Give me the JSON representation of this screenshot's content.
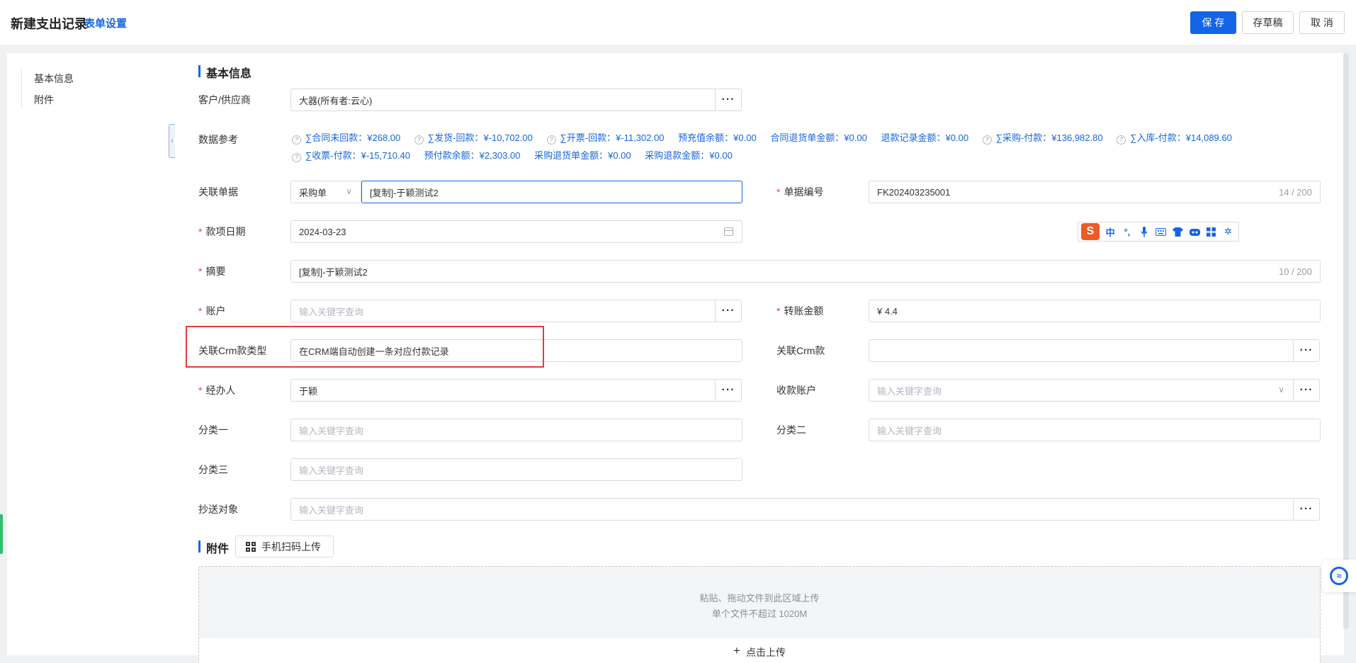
{
  "header": {
    "title": "新建支出记录",
    "form_settings": "表单设置",
    "save": "保 存",
    "save_draft": "存草稿",
    "cancel": "取 消"
  },
  "sidebar": {
    "items": [
      {
        "label": "基本信息"
      },
      {
        "label": "附件"
      }
    ]
  },
  "basic": {
    "section_title": "基本信息",
    "customer": {
      "label": "客户/供应商",
      "value": "大器(所有者:云心)"
    },
    "data_ref": {
      "label": "数据参考",
      "line1": [
        {
          "text": "∑合同未回款：¥268.00",
          "help": true
        },
        {
          "text": "∑发货-回款：¥-10,702.00",
          "help": true
        },
        {
          "text": "∑开票-回款：¥-11,302.00",
          "help": true
        },
        {
          "text": "预充值余额：¥0.00",
          "help": false
        },
        {
          "text": "合同退货单金额：¥0.00",
          "help": false
        },
        {
          "text": "退款记录金额：¥0.00",
          "help": false
        },
        {
          "text": "∑采购-付款：¥136,982.80",
          "help": true
        },
        {
          "text": "∑入库-付款：¥14,089.60",
          "help": true
        }
      ],
      "line2": [
        {
          "text": "∑收票-付款：¥-15,710.40",
          "help": true
        },
        {
          "text": "预付款余额：¥2,303.00",
          "help": false
        },
        {
          "text": "采购退货单金额：¥0.00",
          "help": false
        },
        {
          "text": "采购退款金额：¥0.00",
          "help": false
        }
      ]
    },
    "related_doc": {
      "label": "关联单据",
      "type": "采购单",
      "value": "[复制]-于颖测试2"
    },
    "doc_no": {
      "label": "单据编号",
      "value": "FK202403235001",
      "count": "14 / 200"
    },
    "date": {
      "label": "款项日期",
      "value": "2024-03-23"
    },
    "summary": {
      "label": "摘要",
      "value": "[复制]-于颖测试2",
      "count": "10 / 200"
    },
    "account": {
      "label": "账户",
      "placeholder": "输入关键字查询"
    },
    "transfer_amount": {
      "label": "转账金额",
      "value": "¥  4.4"
    },
    "crm_type": {
      "label": "关联Crm款类型",
      "value": "在CRM端自动创建一条对应付款记录"
    },
    "crm_payment": {
      "label": "关联Crm款",
      "value": ""
    },
    "handler": {
      "label": "经办人",
      "value": "于颖"
    },
    "receiving_account": {
      "label": "收款账户",
      "placeholder": "输入关键字查询"
    },
    "category1": {
      "label": "分类一",
      "placeholder": "输入关键字查询"
    },
    "category2": {
      "label": "分类二",
      "placeholder": "输入关键字查询"
    },
    "category3": {
      "label": "分类三",
      "placeholder": "输入关键字查询"
    },
    "cc": {
      "label": "抄送对象",
      "placeholder": "输入关键字查询"
    }
  },
  "attachment": {
    "section_title": "附件",
    "scan_button": "手机扫码上传",
    "hint1": "粘贴、拖动文件到此区域上传",
    "hint2": "单个文件不超过 1020M",
    "upload": "点击上传"
  },
  "ime": {
    "logo": "S",
    "mode": "中",
    "icons": [
      "punctuation-icon",
      "microphone-icon",
      "keyboard-icon",
      "skin-icon",
      "robot-icon",
      "toolbox-icon",
      "settings-icon"
    ]
  },
  "colors": {
    "primary": "#1464e8",
    "required": "#e8423b",
    "highlight": "#e8383f"
  }
}
